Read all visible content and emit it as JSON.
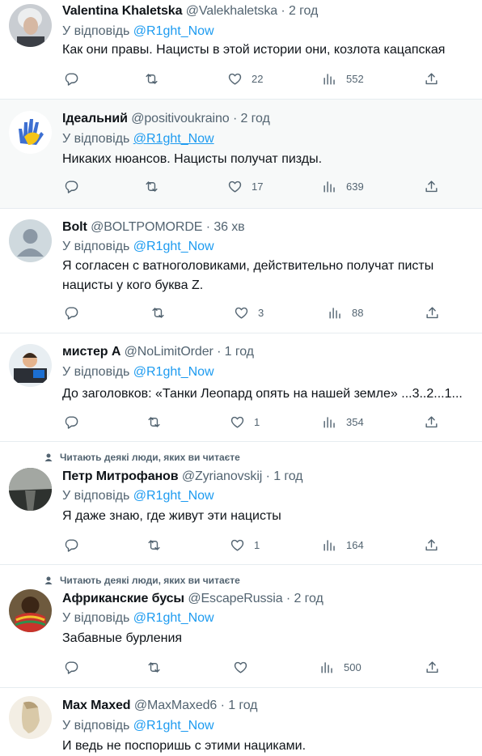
{
  "reply_prefix": "У відповідь",
  "social_context": "Читають деякі люди, яких ви читаєте",
  "tweets": [
    {
      "name": "Valentina Khaletska",
      "handle": "@Valekhaletska",
      "sep": "·",
      "time": "2 год",
      "mention": "@R1ght_Now",
      "lines": [
        "Как они правы. Нацисты в этой истории они, козлота кацапская"
      ],
      "likes": "22",
      "views": "552"
    },
    {
      "name": "Ідеальний",
      "handle": "@positivoukraino",
      "sep": "·",
      "time": "2 год",
      "mention": "@R1ght_Now",
      "lines": [
        "Никаких нюансов. Нацисты получат пизды."
      ],
      "likes": "17",
      "views": "639"
    },
    {
      "name": "Bolt",
      "handle": "@BOLTPOMORDE",
      "sep": "·",
      "time": "36 хв",
      "mention": "@R1ght_Now",
      "lines": [
        "Я согласен с ватноголовиками, действительно получат писты",
        "нацисты у кого буква Z."
      ],
      "likes": "3",
      "views": "88"
    },
    {
      "name": "мистер А",
      "handle": "@NoLimitOrder",
      "sep": "·",
      "time": "1 год",
      "mention": "@R1ght_Now",
      "lines": [
        "До заголовков: «Танки Леопард опять на нашей земле» ...3..2...1..."
      ],
      "likes": "1",
      "views": "354"
    },
    {
      "name": "Петр Митрофанов",
      "handle": "@Zyrianovskij",
      "sep": "·",
      "time": "1 год",
      "mention": "@R1ght_Now",
      "lines": [
        "Я даже знаю, где живут эти нацисты"
      ],
      "likes": "1",
      "views": "164"
    },
    {
      "name": "Африканские бусы",
      "handle": "@EscapeRussia",
      "sep": "·",
      "time": "2 год",
      "mention": "@R1ght_Now",
      "lines": [
        "Забавные бурления"
      ],
      "likes": "",
      "views": "500"
    },
    {
      "name": "Max Maxed",
      "handle": "@MaxMaxed6",
      "sep": "·",
      "time": "1 год",
      "mention": "@R1ght_Now",
      "lines": [
        "И ведь не поспоришь с этими нациками."
      ],
      "likes": "",
      "views": ""
    }
  ],
  "colors": {
    "link": "#1d9bf0",
    "muted": "#536471",
    "text": "#0f1419",
    "divider": "#e6ecf0",
    "highlight": "#f7f9f9"
  }
}
